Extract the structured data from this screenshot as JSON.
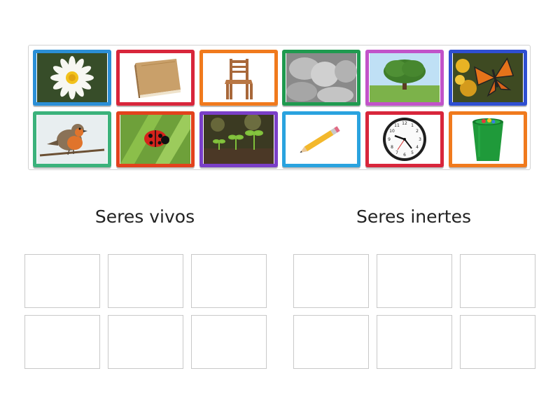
{
  "items": [
    {
      "name": "daisy-card",
      "icon": "daisy-image",
      "border": "#2b8fd6"
    },
    {
      "name": "book-card",
      "icon": "book-image",
      "border": "#d8263b"
    },
    {
      "name": "chair-card",
      "icon": "chair-image",
      "border": "#f07a1d"
    },
    {
      "name": "stones-card",
      "icon": "stones-image",
      "border": "#1f9a4f"
    },
    {
      "name": "tree-card",
      "icon": "tree-image",
      "border": "#c153c9"
    },
    {
      "name": "butterfly-card",
      "icon": "butterfly-image",
      "border": "#2f4fd1"
    },
    {
      "name": "robin-card",
      "icon": "robin-image",
      "border": "#3bb27b"
    },
    {
      "name": "ladybug-card",
      "icon": "ladybug-image",
      "border": "#e2421d"
    },
    {
      "name": "sprouts-card",
      "icon": "sprouts-image",
      "border": "#7a3fc8"
    },
    {
      "name": "pencil-card",
      "icon": "pencil-image",
      "border": "#2aa3df"
    },
    {
      "name": "clock-card",
      "icon": "clock-image",
      "border": "#d8263b"
    },
    {
      "name": "bin-card",
      "icon": "bin-image",
      "border": "#f07a1d"
    }
  ],
  "groups": {
    "left": {
      "title": "Seres vivos"
    },
    "right": {
      "title": "Seres inertes"
    }
  }
}
